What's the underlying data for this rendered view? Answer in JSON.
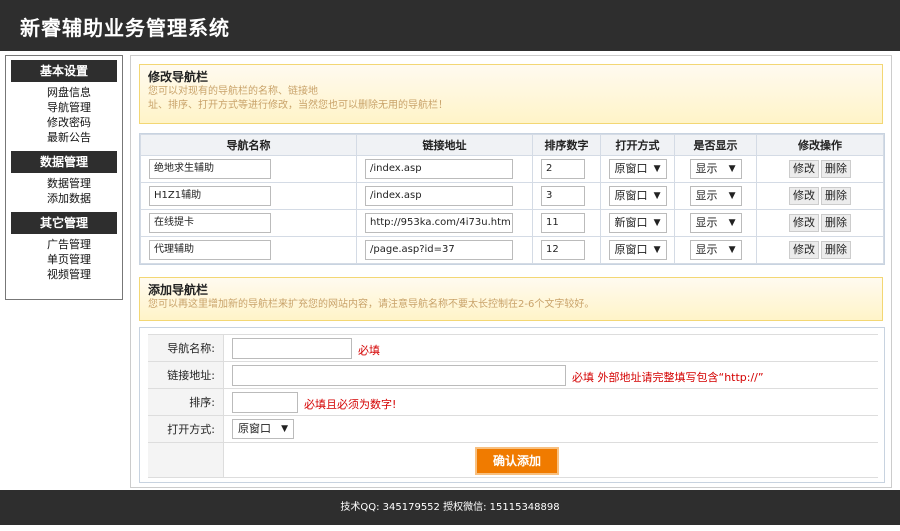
{
  "header": {
    "title": "新睿辅助业务管理系统"
  },
  "sidebar": {
    "groups": [
      {
        "title": "基本设置",
        "items": [
          "网盘信息",
          "导航管理",
          "修改密码",
          "最新公告"
        ]
      },
      {
        "title": "数据管理",
        "items": [
          "数据管理",
          "添加数据"
        ]
      },
      {
        "title": "其它管理",
        "items": [
          "广告管理",
          "单页管理",
          "视频管理"
        ]
      }
    ]
  },
  "edit_section": {
    "title": "修改导航栏",
    "desc_line1": "您可以对现有的导航栏的名称、链接地",
    "desc_line2": "址、排序、打开方式等进行修改，当然您也可以删除无用的导航栏！"
  },
  "nav_table": {
    "headers": [
      "导航名称",
      "链接地址",
      "排序数字",
      "打开方式",
      "是否显示",
      "修改操作"
    ],
    "rows": [
      {
        "name": "绝地求生辅助",
        "url": "/index.asp",
        "order": "2",
        "open": "原窗口",
        "show": "显示"
      },
      {
        "name": "H1Z1辅助",
        "url": "/index.asp",
        "order": "3",
        "open": "原窗口",
        "show": "显示"
      },
      {
        "name": "在线提卡",
        "url": "http://953ka.com/4i73u.htm",
        "order": "11",
        "open": "新窗口",
        "show": "显示"
      },
      {
        "name": "代理辅助",
        "url": "/page.asp?id=37",
        "order": "12",
        "open": "原窗口",
        "show": "显示"
      }
    ],
    "edit_label": "修改",
    "delete_label": "删除"
  },
  "add_section": {
    "title": "添加导航栏",
    "desc": "您可以再这里增加新的导航栏来扩充您的网站内容，请注意导航名称不要太长控制在2-6个文字较好。"
  },
  "add_form": {
    "name_label": "导航名称:",
    "name_hint": "必填",
    "url_label": "链接地址:",
    "url_hint": "必填 外部地址请完整填写包含“http://”",
    "order_label": "排序:",
    "order_hint": "必填且必须为数字!",
    "open_label": "打开方式:",
    "open_value": "原窗口",
    "submit_label": "确认添加"
  },
  "footer": {
    "text": "技术QQ: 345179552 授权微信: 15115348898"
  }
}
